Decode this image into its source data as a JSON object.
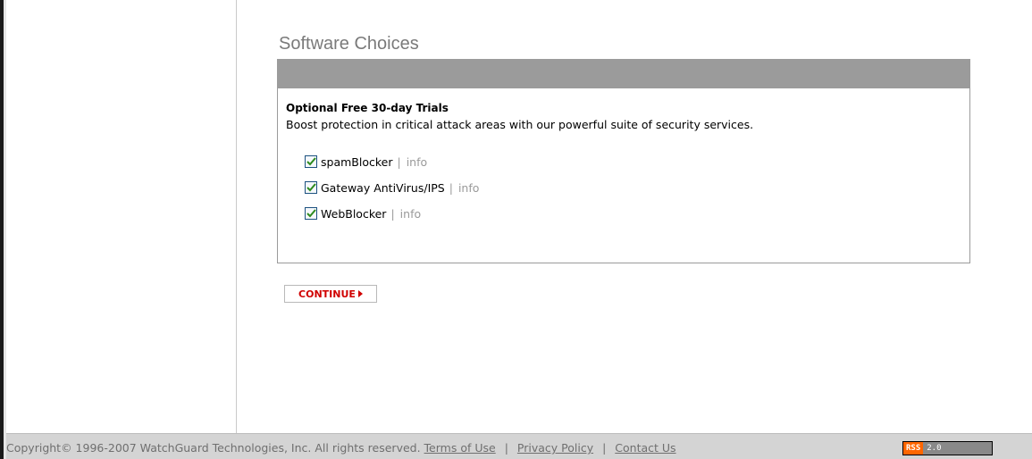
{
  "page": {
    "title": "Software Choices"
  },
  "trials": {
    "heading": "Optional Free 30-day Trials",
    "description": "Boost protection in critical attack areas with our powerful suite of security services.",
    "options": [
      {
        "label": "spamBlocker",
        "checked": true,
        "separator": "|",
        "info": "info"
      },
      {
        "label": "Gateway AntiVirus/IPS",
        "checked": true,
        "separator": "|",
        "info": "info"
      },
      {
        "label": "WebBlocker",
        "checked": true,
        "separator": "|",
        "info": "info"
      }
    ]
  },
  "continue_button": {
    "label": "CONTINUE"
  },
  "footer": {
    "copyright": "Copyright© 1996-2007 WatchGuard Technologies, Inc. All rights reserved.",
    "links": [
      "Terms of Use",
      "Privacy Policy",
      "Contact Us"
    ],
    "separator": "|",
    "rss_label": "RSS",
    "rss_version": "2.0"
  },
  "colors": {
    "panel_header": "#9b9b9b",
    "continue_text": "#d00000",
    "rss_orange": "#ff6600",
    "footer_bg": "#d4d4d4",
    "checkbox_check": "#2e8b1e"
  },
  "icons": {
    "checkbox": "checkmark-icon",
    "continue": "play-arrow-icon"
  }
}
